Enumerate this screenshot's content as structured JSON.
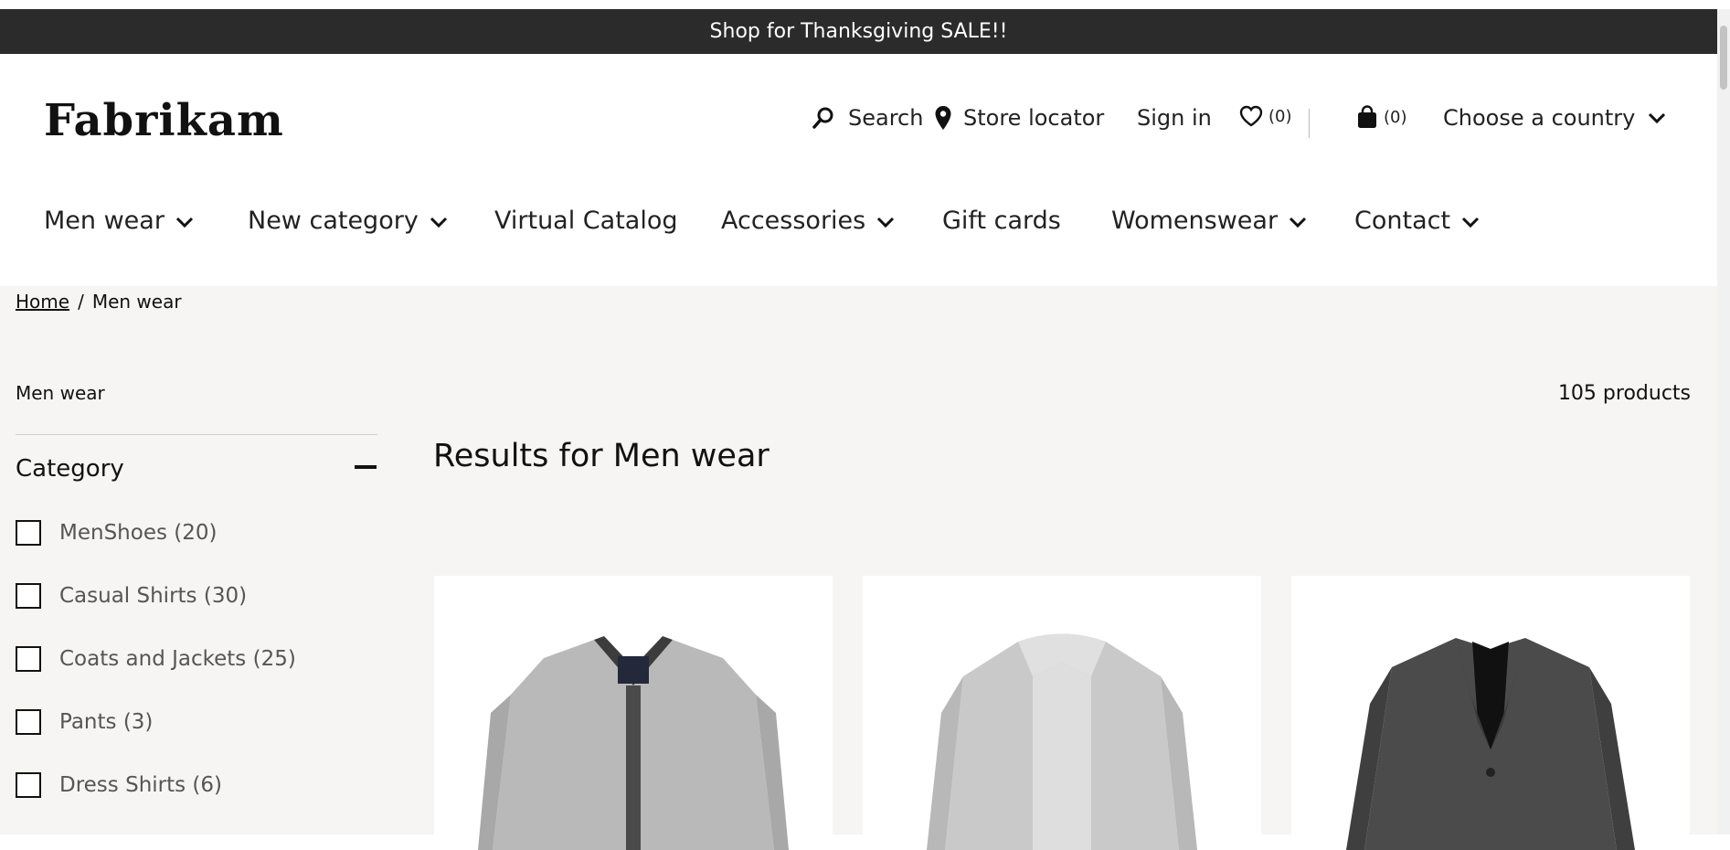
{
  "promo": {
    "text": "Shop for Thanksgiving SALE!!"
  },
  "header": {
    "logo": "Fabrikam",
    "search_label": "Search",
    "store_locator_label": "Store locator",
    "sign_in_label": "Sign in",
    "wishlist_count": "(0)",
    "cart_count": "(0)",
    "country_label": "Choose a country"
  },
  "nav": {
    "items": [
      {
        "label": "Men wear",
        "has_dropdown": true
      },
      {
        "label": "New category",
        "has_dropdown": true
      },
      {
        "label": "Virtual Catalog",
        "has_dropdown": false
      },
      {
        "label": "Accessories",
        "has_dropdown": true
      },
      {
        "label": "Gift cards",
        "has_dropdown": false
      },
      {
        "label": "Womenswear",
        "has_dropdown": true
      },
      {
        "label": "Contact",
        "has_dropdown": true
      }
    ]
  },
  "breadcrumb": {
    "home": "Home",
    "separator": "/",
    "current": "Men wear"
  },
  "sidebar": {
    "title": "Men wear",
    "category_heading": "Category",
    "filters": [
      {
        "label": "MenShoes (20)",
        "checked": false
      },
      {
        "label": "Casual Shirts (30)",
        "checked": false
      },
      {
        "label": "Coats and Jackets (25)",
        "checked": false
      },
      {
        "label": "Pants (3)",
        "checked": false
      },
      {
        "label": "Dress Shirts (6)",
        "checked": false
      }
    ]
  },
  "main": {
    "product_count": "105 products",
    "results_title": "Results for Men wear",
    "products": [
      {
        "image": "grey-cardigan-image"
      },
      {
        "image": "light-grey-open-cardigan-image"
      },
      {
        "image": "dark-grey-blazer-image"
      }
    ]
  },
  "colors": {
    "promo_bg": "#2b2b2b",
    "content_bg": "#f6f5f4",
    "text": "#111111"
  }
}
